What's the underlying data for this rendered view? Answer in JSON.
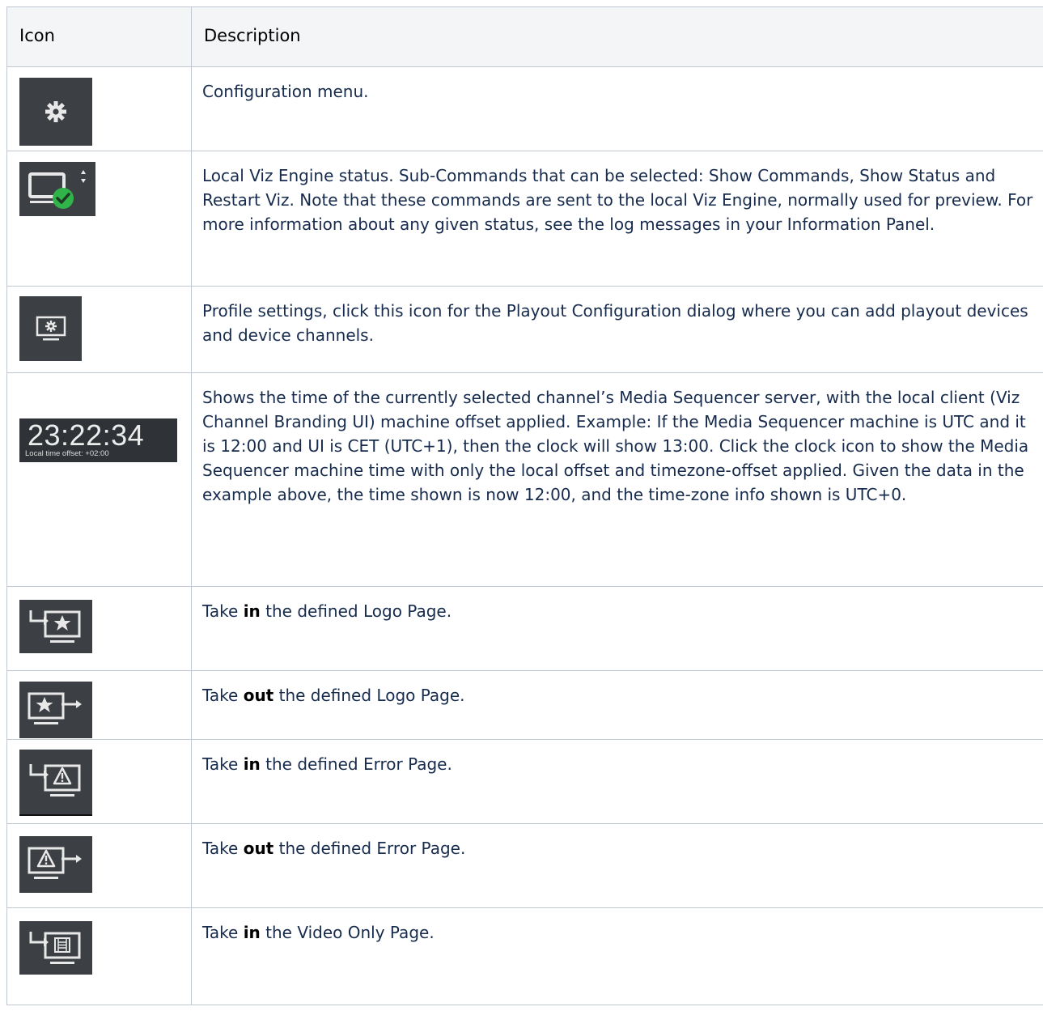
{
  "header": {
    "icon_col": "Icon",
    "description_col": "Description"
  },
  "rows": [
    {
      "icon": "gear-icon",
      "description": "Configuration menu."
    },
    {
      "icon": "engine-status-icon",
      "description": "Local Viz Engine status. Sub-Commands that can be selected: Show Commands, Show Status and Restart Viz. Note that these commands are sent to the local Viz Engine, normally used for preview. For more information about any given status, see the log messages in your Information Panel."
    },
    {
      "icon": "profile-settings-icon",
      "description": "Profile settings, click this icon for the Playout Configuration dialog where you can add playout devices and device channels."
    },
    {
      "icon": "clock-icon",
      "clock_time": "23:22:34",
      "clock_offset": "Local time offset: +02:00",
      "description": "Shows the time of the currently selected channel’s Media Sequencer server, with the local client (Viz Channel Branding UI) machine offset applied. Example: If the Media Sequencer machine is UTC and it is 12:00 and UI is CET (UTC+1), then the clock will show 13:00. Click the clock icon to show the Media Sequencer machine time with only the local offset and timezone-offset applied. Given the data in the example above, the time shown is now 12:00, and the time-zone info shown is UTC+0."
    },
    {
      "icon": "take-in-logo-icon",
      "pre": "Take ",
      "keyword": "in",
      "post": " the defined Logo Page."
    },
    {
      "icon": "take-out-logo-icon",
      "pre": "Take ",
      "keyword": "out",
      "post": " the defined Logo Page."
    },
    {
      "icon": "take-in-error-icon",
      "pre": "Take ",
      "keyword": "in",
      "post": " the defined Error Page."
    },
    {
      "icon": "take-out-error-icon",
      "pre": "Take ",
      "keyword": "out",
      "post": " the defined Error Page."
    },
    {
      "icon": "take-in-video-icon",
      "pre": "Take ",
      "keyword": "in",
      "post": " the Video Only Page."
    }
  ]
}
